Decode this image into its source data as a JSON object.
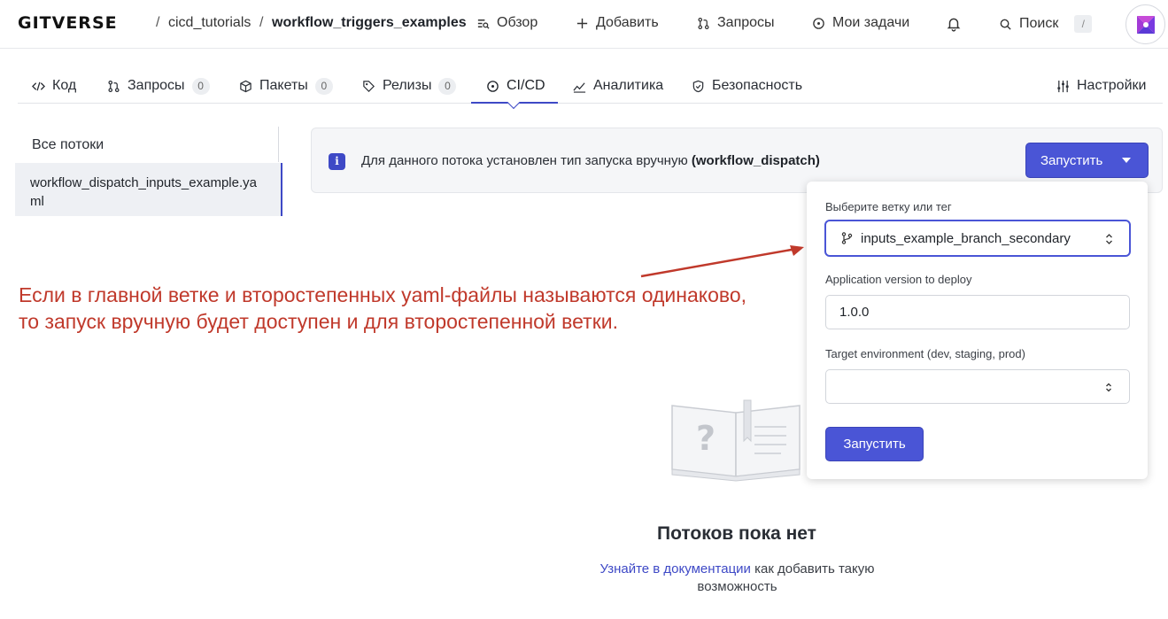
{
  "header": {
    "logo": "GITVERSE",
    "breadcrumb": {
      "owner": "cicd_tutorials",
      "sep": "/",
      "repo": "workflow_triggers_examples"
    },
    "nav": {
      "overview": "Обзор",
      "add": "Добавить",
      "requests": "Запросы",
      "tasks": "Мои задачи",
      "search": "Поиск",
      "search_key": "/"
    }
  },
  "tabs": {
    "code": "Код",
    "requests": "Запросы",
    "requests_count": "0",
    "packages": "Пакеты",
    "packages_count": "0",
    "releases": "Релизы",
    "releases_count": "0",
    "cicd": "CI/CD",
    "analytics": "Аналитика",
    "security": "Безопасность",
    "settings": "Настройки"
  },
  "sidebar": {
    "all": "Все потоки",
    "selected": "workflow_dispatch_inputs_example.yaml"
  },
  "banner": {
    "text": "Для данного потока установлен тип запуска вручную ",
    "bold": "(workflow_dispatch)",
    "button": "Запустить"
  },
  "panel": {
    "branch_label": "Выберите ветку или тег",
    "branch_value": "inputs_example_branch_secondary",
    "version_label": "Application version to deploy",
    "version_value": "1.0.0",
    "env_label": "Target environment (dev, staging, prod)",
    "env_value": "",
    "submit": "Запустить"
  },
  "annotation": {
    "line1": "Если в главной ветке и второстепенных yaml-файлы называются одинаково,",
    "line2": "то запуск вручную будет доступен и для второстепенной ветки."
  },
  "empty": {
    "title": "Потоков пока нет",
    "link": "Узнайте в документации",
    "text": " как добавить такую возможность"
  },
  "colors": {
    "accent": "#4a55d6",
    "annotation": "#c0392b"
  }
}
